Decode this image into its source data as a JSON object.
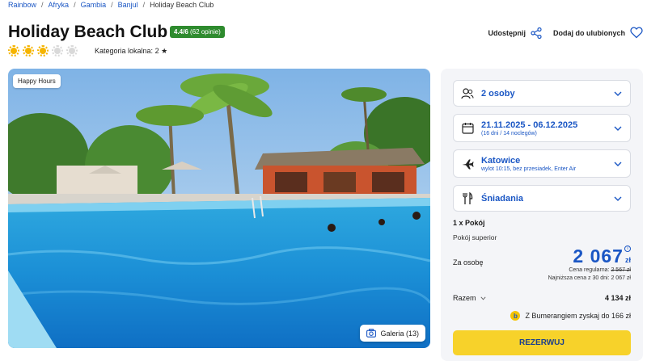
{
  "breadcrumb": [
    "Rainbow",
    "Afryka",
    "Gambia",
    "Banjul",
    "Holiday Beach Club"
  ],
  "hotel": {
    "name": "Holiday Beach Club",
    "rating_score": "4.4/6",
    "rating_count": "(62 opinie)",
    "sun_rating": 3,
    "sun_max": 5,
    "local_category_label": "Kategoria lokalna:",
    "local_category_value": "2"
  },
  "actions": {
    "share_label": "Udostępnij",
    "favorite_label": "Dodaj do ulubionych"
  },
  "photo": {
    "badge": "Happy Hours",
    "gallery_label": "Galeria (13)"
  },
  "booking": {
    "travelers": "2 osoby",
    "dates": "21.11.2025 - 06.12.2025",
    "dates_detail": "(16 dni / 14 noclegów)",
    "departure_city": "Katowice",
    "departure_detail": "wylot 10:15, bez przesiadek, Enter Air",
    "board": "Śniadania",
    "room_count": "1 x Pokój",
    "room_type": "Pokój superior",
    "per_person_label": "Za osobę",
    "price_amount": "2 067",
    "price_currency": "zł",
    "regular_label": "Cena regularna:",
    "regular_value": "2 567 zł",
    "lowest_label": "Najniższa cena z 30 dni:",
    "lowest_value": "2 067 zł",
    "total_label": "Razem",
    "total_value": "4 134 zł",
    "bumerang_text": "Z Bumerangiem zyskaj do 166 zł",
    "reserve_label": "REZERWUJ"
  },
  "colors": {
    "link_blue": "#1a56c4",
    "rating_green": "#2e8b2e",
    "sun_yellow": "#f5b400",
    "reserve_yellow": "#f7d22a"
  }
}
